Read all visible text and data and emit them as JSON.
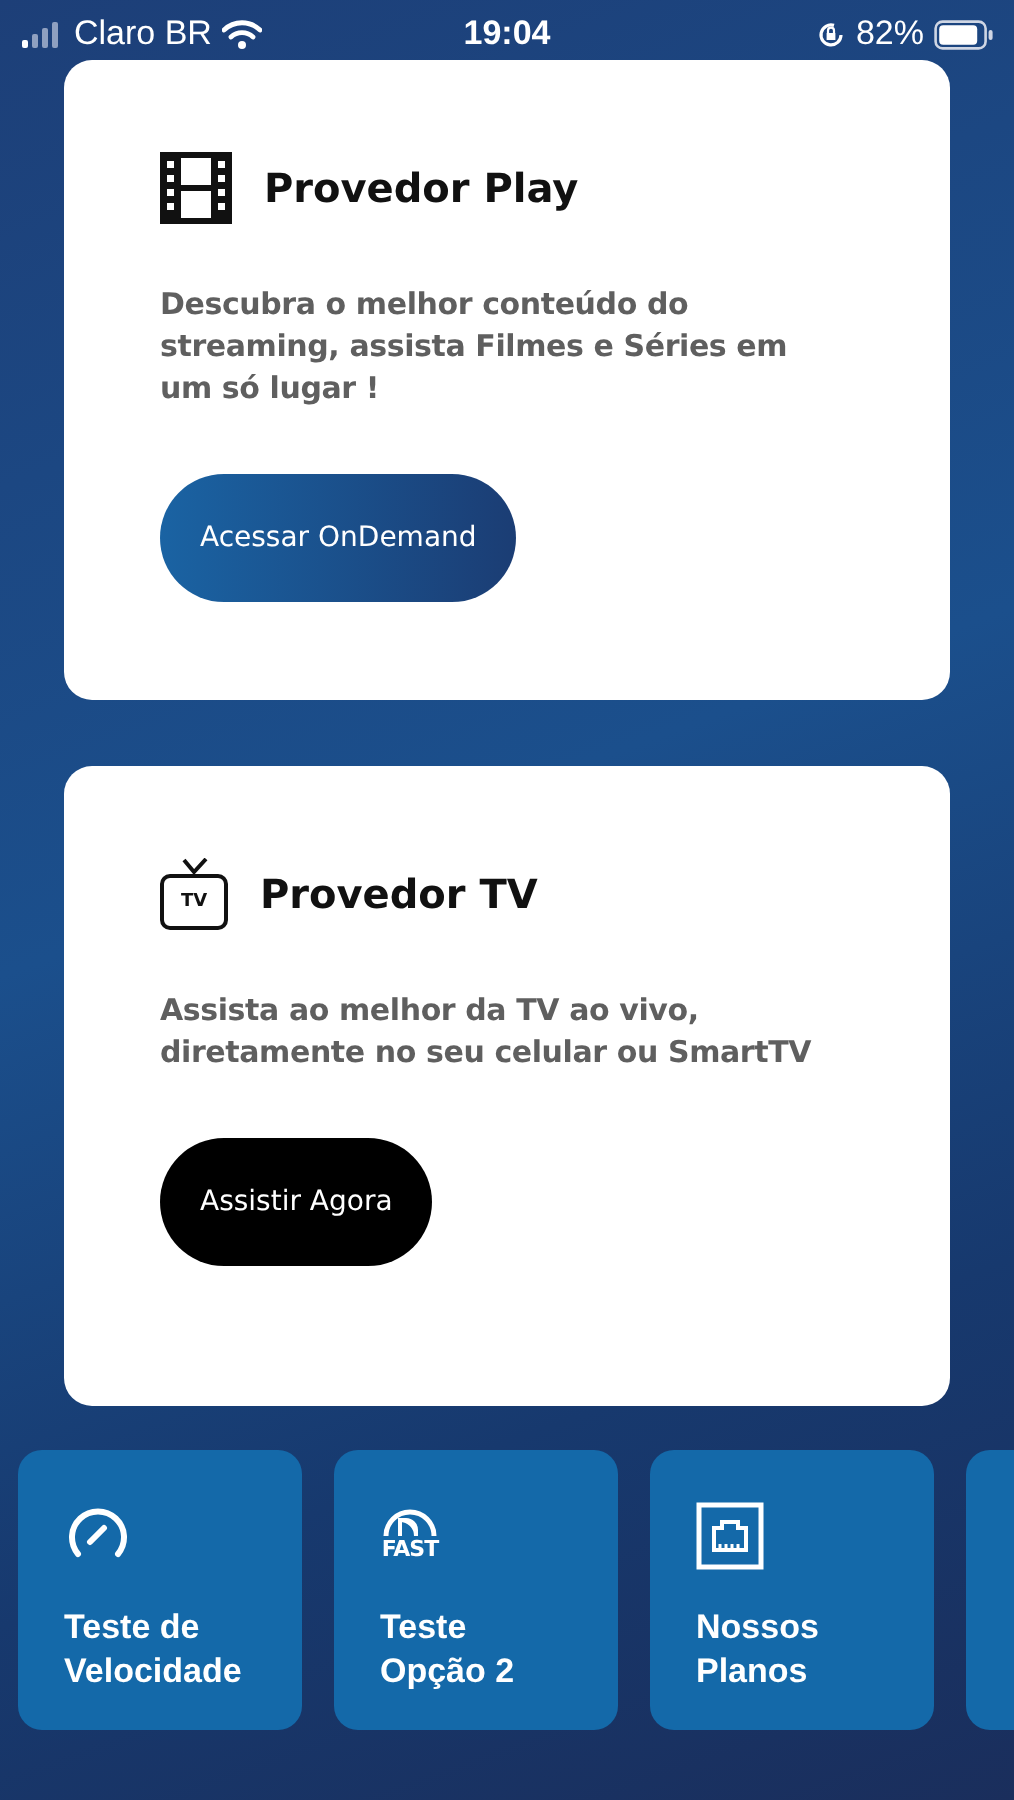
{
  "status_bar": {
    "carrier": "Claro BR",
    "time": "19:04",
    "battery": "82%"
  },
  "cards": [
    {
      "kind": "film",
      "title": "Provedor Play",
      "description": "Descubra o melhor conteúdo do streaming, assista Filmes e Séries em um só lugar !",
      "button": {
        "label": "Acessar OnDemand",
        "kind": "gradient"
      }
    },
    {
      "kind": "tv",
      "icon_text": "TV",
      "title": "Provedor TV",
      "description": "Assista ao melhor da TV ao vivo, diretamente no seu celular ou SmartTV",
      "button": {
        "label": "Assistir Agora",
        "kind": "dark"
      }
    }
  ],
  "tiles": [
    {
      "kind": "gauge",
      "label": "Teste de Velocidade"
    },
    {
      "kind": "fast",
      "icon_text": "FAST",
      "label": "Teste Opção 2"
    },
    {
      "kind": "ethernet",
      "label": "Nossos Planos"
    },
    {
      "kind": "blank"
    }
  ]
}
